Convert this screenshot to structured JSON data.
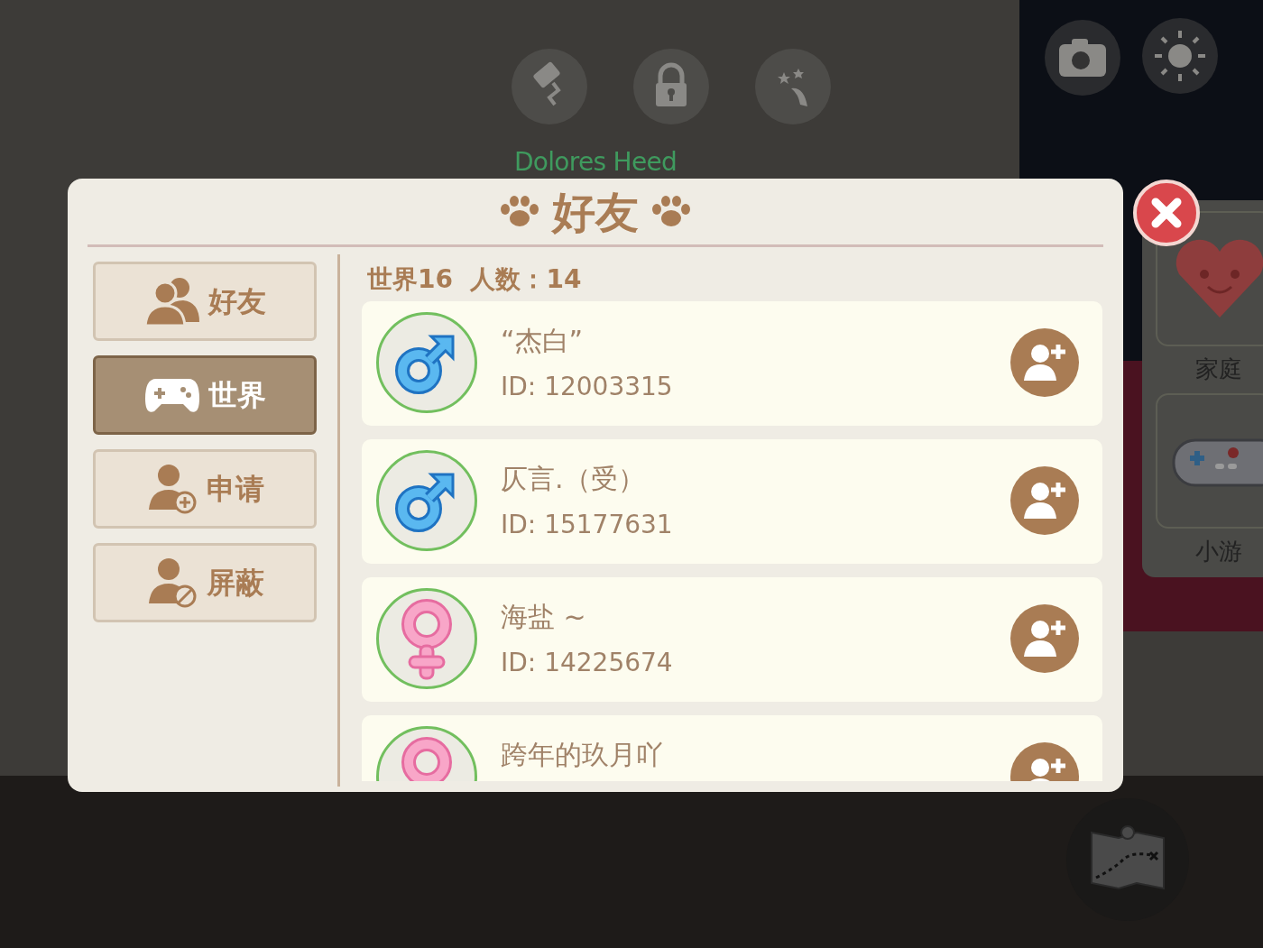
{
  "hud": {
    "player_name": "Dolores Heed"
  },
  "side_panel": {
    "items": [
      {
        "label": "家庭",
        "kind": "heart"
      },
      {
        "label": "小游",
        "kind": "gamepad"
      }
    ]
  },
  "dialog": {
    "title": "好友",
    "tabs": [
      {
        "label": "好友",
        "kind": "friends",
        "selected": false
      },
      {
        "label": "世界",
        "kind": "world",
        "selected": true
      },
      {
        "label": "申请",
        "kind": "request",
        "selected": false
      },
      {
        "label": "屏蔽",
        "kind": "block",
        "selected": false
      }
    ],
    "list_header": "世界16  人数：14",
    "players": [
      {
        "name": "“杰白”",
        "id": "ID: 12003315",
        "kind": "male"
      },
      {
        "name": "仄言.（受）",
        "id": "ID: 15177631",
        "kind": "male"
      },
      {
        "name": "海盐 ~",
        "id": "ID: 14225674",
        "kind": "female"
      },
      {
        "name": "跨年的玖月吖",
        "kind": "female"
      }
    ]
  }
}
